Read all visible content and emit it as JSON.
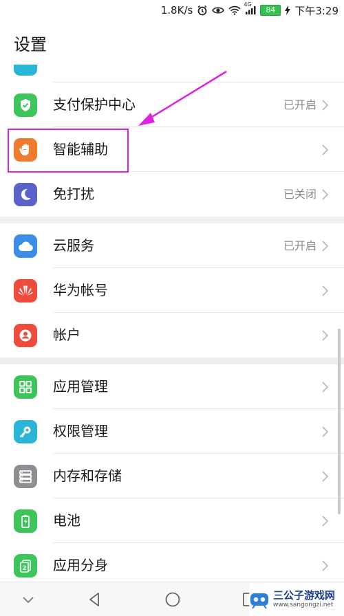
{
  "status_bar": {
    "speed": "1.8K/s",
    "network": "4G",
    "battery": "84",
    "time": "下午3:29",
    "icons": [
      "alarm-icon",
      "eye-icon",
      "wifi-icon",
      "signal-icon",
      "charging-icon"
    ]
  },
  "header": {
    "title": "设置"
  },
  "groups": [
    {
      "items": [
        {
          "label": "支付保护中心",
          "status": "已开启",
          "icon": "shield-check-icon",
          "color": "#3dc45a"
        },
        {
          "label": "智能辅助",
          "status": "",
          "icon": "hand-icon",
          "color": "#f07a2d"
        },
        {
          "label": "免打扰",
          "status": "已关闭",
          "icon": "moon-icon",
          "color": "#5b63c9"
        }
      ]
    },
    {
      "items": [
        {
          "label": "云服务",
          "status": "已开启",
          "icon": "cloud-icon",
          "color": "#3b8de6"
        },
        {
          "label": "华为帐号",
          "status": "",
          "icon": "huawei-logo-icon",
          "color": "#ef4b3c"
        },
        {
          "label": "帐户",
          "status": "",
          "icon": "account-icon",
          "color": "#ef4b3c"
        }
      ]
    },
    {
      "items": [
        {
          "label": "应用管理",
          "status": "",
          "icon": "app-grid-icon",
          "color": "#3dc45a"
        },
        {
          "label": "权限管理",
          "status": "",
          "icon": "key-icon",
          "color": "#29b4d8"
        },
        {
          "label": "内存和存储",
          "status": "",
          "icon": "storage-icon",
          "color": "#8e8e93"
        },
        {
          "label": "电池",
          "status": "",
          "icon": "battery-icon",
          "color": "#3dc45a"
        },
        {
          "label": "应用分身",
          "status": "",
          "icon": "app-twin-icon",
          "color": "#3dc45a"
        }
      ]
    }
  ],
  "watermark": {
    "title": "三公子游戏网",
    "url": "www.sangongzi.net"
  },
  "annotation": {
    "highlight_color": "#e020e0"
  }
}
